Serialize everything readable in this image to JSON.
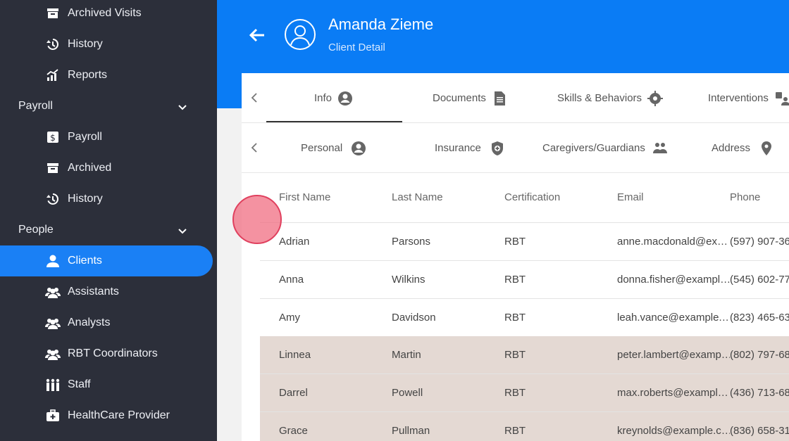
{
  "sidebar": {
    "items": [
      {
        "label": "Archived Visits",
        "icon": "archive-icon"
      },
      {
        "label": "History",
        "icon": "history-icon"
      },
      {
        "label": "Reports",
        "icon": "reports-icon"
      }
    ],
    "payroll_section": "Payroll",
    "payroll_items": [
      {
        "label": "Payroll",
        "icon": "payroll-icon"
      },
      {
        "label": "Archived",
        "icon": "archive-icon"
      },
      {
        "label": "History",
        "icon": "history-icon"
      }
    ],
    "people_section": "People",
    "people_items": [
      {
        "label": "Clients",
        "icon": "person-icon"
      },
      {
        "label": "Assistants",
        "icon": "group-icon"
      },
      {
        "label": "Analysts",
        "icon": "group-icon"
      },
      {
        "label": "RBT Coordinators",
        "icon": "group-icon"
      },
      {
        "label": "Staff",
        "icon": "staff-icon"
      },
      {
        "label": "HealthCare Provider",
        "icon": "medkit-icon"
      }
    ]
  },
  "header": {
    "name": "Amanda Zieme",
    "subtitle": "Client Detail"
  },
  "tabs": [
    "Info",
    "Documents",
    "Skills & Behaviors",
    "Interventions"
  ],
  "subtabs": [
    "Personal",
    "Insurance",
    "Caregivers/Guardians",
    "Address"
  ],
  "table": {
    "headers": [
      "First Name",
      "Last Name",
      "Certification",
      "Email",
      "Phone"
    ],
    "rows": [
      [
        "Adrian",
        "Parsons",
        "RBT",
        "anne.macdonald@ex…",
        "(597) 907-36"
      ],
      [
        "Anna",
        "Wilkins",
        "RBT",
        "donna.fisher@exampl…",
        "(545) 602-77"
      ],
      [
        "Amy",
        "Davidson",
        "RBT",
        "leah.vance@example.…",
        "(823) 465-63"
      ],
      [
        "Linnea",
        "Martin",
        "RBT",
        "peter.lambert@examp…",
        "(802) 797-68"
      ],
      [
        "Darrel",
        "Powell",
        "RBT",
        "max.roberts@exampl…",
        "(436) 713-68"
      ],
      [
        "Grace",
        "Pullman",
        "RBT",
        "kreynolds@example.c…",
        "(836) 658-31"
      ]
    ]
  },
  "colors": {
    "sidebar_bg": "#2c2f3a",
    "accent": "#1a80f5",
    "header_bg": "#0a7cf5",
    "highlight_row": "#e4d9d3"
  }
}
